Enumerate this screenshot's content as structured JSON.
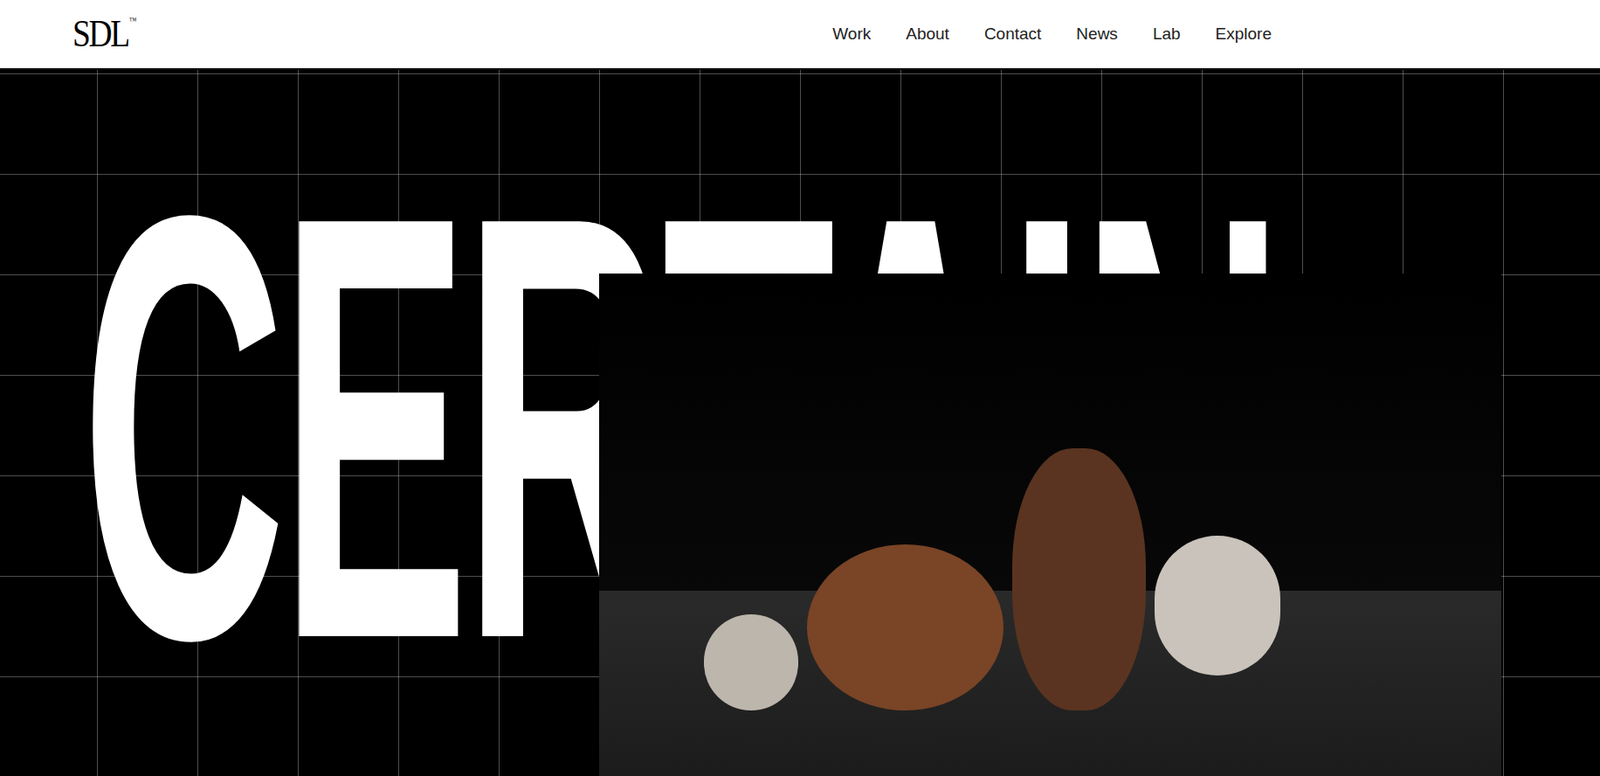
{
  "header": {
    "logo": "SDL",
    "logo_mark": "™",
    "nav": [
      {
        "label": "Work"
      },
      {
        "label": "About"
      },
      {
        "label": "Contact"
      },
      {
        "label": "News"
      },
      {
        "label": "Lab"
      },
      {
        "label": "Explore"
      }
    ]
  },
  "hero": {
    "title": "CERTAIN"
  }
}
